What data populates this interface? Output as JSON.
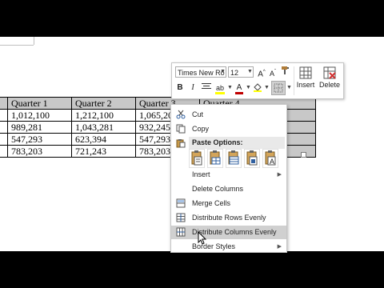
{
  "table": {
    "header": [
      "",
      "Quarter 1",
      "Quarter 2",
      "Quarter 3",
      "Quarter 4"
    ],
    "rows": [
      [
        "",
        "1,012,100",
        "1,212,100",
        "1,065,200",
        ""
      ],
      [
        "",
        "989,281",
        "1,043,281",
        "932,245",
        ""
      ],
      [
        "",
        "547,293",
        "623,394",
        "547,293",
        ""
      ],
      [
        "",
        "783,203",
        "721,243",
        "783,203",
        ""
      ]
    ]
  },
  "mini_toolbar": {
    "font_name": "Times New Ro",
    "font_size": "12",
    "bold": "B",
    "italic": "I",
    "insert_label": "Insert",
    "delete_label": "Delete"
  },
  "context_menu": {
    "cut": "Cut",
    "copy": "Copy",
    "paste_options": "Paste Options:",
    "insert": "Insert",
    "delete_columns": "Delete Columns",
    "merge_cells": "Merge Cells",
    "distribute_rows": "Distribute Rows Evenly",
    "distribute_columns": "Distribute Columns Evenly",
    "border_styles": "Border Styles"
  },
  "colors": {
    "highlight": "#ffff00",
    "font_color": "#c00000",
    "menu_hover": "#d0d0d0",
    "selection_gray": "#c8c8c8"
  }
}
